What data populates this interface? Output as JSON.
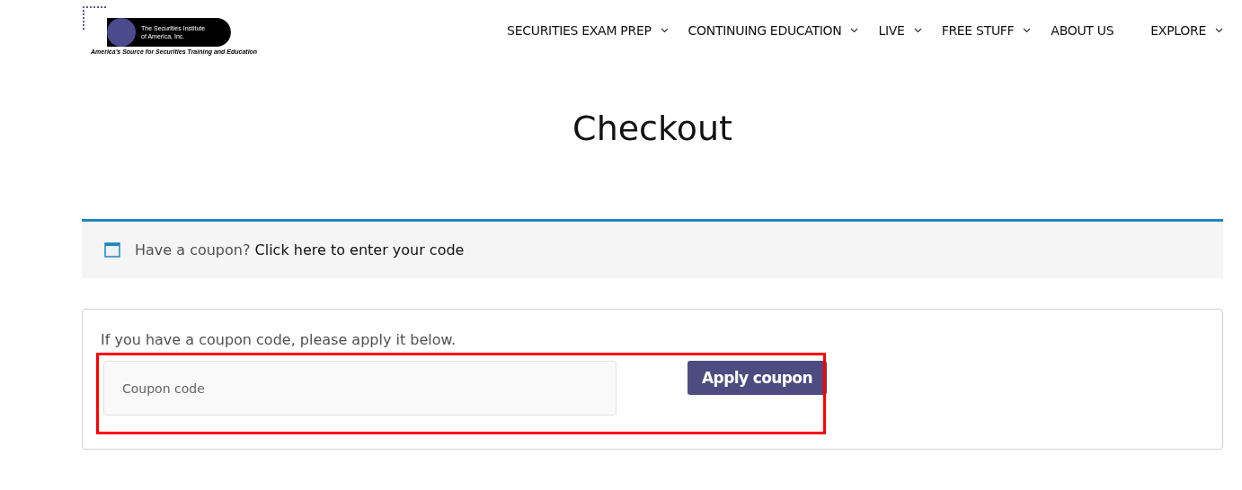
{
  "logo": {
    "name_lines": [
      "The Securities Institute",
      "of America, Inc."
    ],
    "tagline": "America's Source for Securities Training and Education"
  },
  "nav": [
    {
      "label": "SECURITIES EXAM PREP",
      "has_menu": true
    },
    {
      "label": "CONTINUING EDUCATION",
      "has_menu": true
    },
    {
      "label": "LIVE",
      "has_menu": true
    },
    {
      "label": "FREE STUFF",
      "has_menu": true
    },
    {
      "label": "ABOUT US",
      "has_menu": false
    },
    {
      "label": "EXPLORE",
      "has_menu": true
    }
  ],
  "page_title": "Checkout",
  "notice": {
    "text": "Have a coupon?",
    "link": "Click here to enter your code"
  },
  "coupon_form": {
    "intro": "If you have a coupon code, please apply it below.",
    "placeholder": "Coupon code",
    "button": "Apply coupon",
    "highlighted": true
  }
}
